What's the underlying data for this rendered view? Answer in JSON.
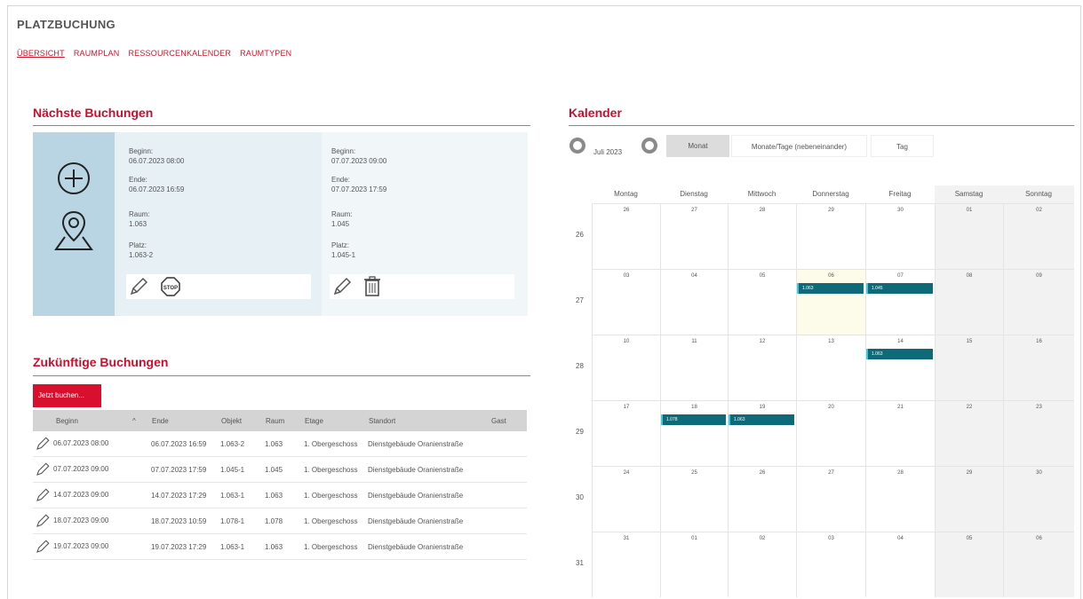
{
  "app": {
    "title": "PLATZBUCHUNG"
  },
  "nav": [
    "ÜBERSICHT",
    "RAUMPLAN",
    "RESSOURCENKALENDER",
    "RAUMTYPEN"
  ],
  "next_bookings": {
    "title": "Nächste Buchungen",
    "cards": [
      {
        "begin_label": "Beginn:",
        "begin": "06.07.2023 08:00",
        "end_label": "Ende:",
        "end": "06.07.2023 16:59",
        "room_label": "Raum:",
        "room": "1.063",
        "seat_label": "Platz:",
        "seat": "1.063-2",
        "actions": [
          "pencil-icon",
          "stop-icon"
        ]
      },
      {
        "begin_label": "Beginn:",
        "begin": "07.07.2023 09:00",
        "end_label": "Ende:",
        "end": "07.07.2023 17:59",
        "room_label": "Raum:",
        "room": "1.045",
        "seat_label": "Platz:",
        "seat": "1.045-1",
        "actions": [
          "pencil-icon",
          "trash-icon"
        ]
      }
    ]
  },
  "future_bookings": {
    "title": "Zukünftige Buchungen",
    "book_button": "Jetzt buchen...",
    "sort_indicator": "^",
    "columns": [
      "Beginn",
      "Ende",
      "Objekt",
      "Raum",
      "Etage",
      "Standort",
      "Gast"
    ],
    "rows": [
      [
        "06.07.2023 08:00",
        "06.07.2023 16:59",
        "1.063-2",
        "1.063",
        "1. Obergeschoss",
        "Dienstgebäude Oranienstraße",
        ""
      ],
      [
        "07.07.2023 09:00",
        "07.07.2023 17:59",
        "1.045-1",
        "1.045",
        "1. Obergeschoss",
        "Dienstgebäude Oranienstraße",
        ""
      ],
      [
        "14.07.2023 09:00",
        "14.07.2023 17:29",
        "1.063-1",
        "1.063",
        "1. Obergeschoss",
        "Dienstgebäude Oranienstraße",
        ""
      ],
      [
        "18.07.2023 09:00",
        "18.07.2023 10:59",
        "1.078-1",
        "1.078",
        "1. Obergeschoss",
        "Dienstgebäude Oranienstraße",
        ""
      ],
      [
        "19.07.2023 09:00",
        "19.07.2023 17:29",
        "1.063-1",
        "1.063",
        "1. Obergeschoss",
        "Dienstgebäude Oranienstraße",
        ""
      ]
    ]
  },
  "calendar": {
    "title": "Kalender",
    "month_label": "Juli 2023",
    "views": [
      "Monat",
      "Monate/Tage (nebeneinander)",
      "Tag"
    ],
    "weekdays": [
      "Montag",
      "Dienstag",
      "Mittwoch",
      "Donnerstag",
      "Freitag",
      "Samstag",
      "Sonntag"
    ],
    "weeks": [
      {
        "num": "26",
        "days": [
          "26",
          "27",
          "28",
          "29",
          "30",
          "01",
          "02"
        ]
      },
      {
        "num": "27",
        "days": [
          "03",
          "04",
          "05",
          "06",
          "07",
          "08",
          "09"
        ]
      },
      {
        "num": "28",
        "days": [
          "10",
          "11",
          "12",
          "13",
          "14",
          "15",
          "16"
        ]
      },
      {
        "num": "29",
        "days": [
          "17",
          "18",
          "19",
          "20",
          "21",
          "22",
          "23"
        ]
      },
      {
        "num": "30",
        "days": [
          "24",
          "25",
          "26",
          "27",
          "28",
          "29",
          "30"
        ]
      },
      {
        "num": "31",
        "days": [
          "31",
          "01",
          "02",
          "03",
          "04",
          "05",
          "06"
        ]
      }
    ],
    "events": [
      {
        "week": 1,
        "day": 3,
        "label": "1.063"
      },
      {
        "week": 1,
        "day": 4,
        "label": "1.045"
      },
      {
        "week": 2,
        "day": 4,
        "label": "1.063"
      },
      {
        "week": 3,
        "day": 1,
        "label": "1.078"
      },
      {
        "week": 3,
        "day": 2,
        "label": "1.063"
      }
    ],
    "today": {
      "week": 1,
      "day": 3
    }
  },
  "colors": {
    "accent": "#c8102e",
    "event": "#0e6a79",
    "panel": "#e6f0f5",
    "panel_icon": "#b9d5e3",
    "weekend": "#f2f2f2",
    "today": "#fdfbea"
  }
}
